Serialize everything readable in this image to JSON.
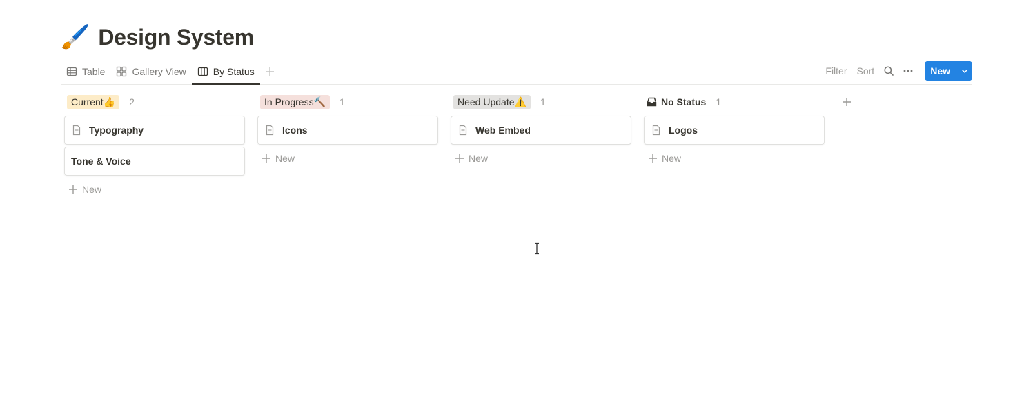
{
  "page": {
    "icon": "🖌️",
    "title": "Design System"
  },
  "views": {
    "tabs": [
      {
        "label": "Table",
        "icon": "table-icon"
      },
      {
        "label": "Gallery View",
        "icon": "gallery-icon"
      },
      {
        "label": "By Status",
        "icon": "board-icon",
        "active": true
      }
    ]
  },
  "toolbar": {
    "filter_label": "Filter",
    "sort_label": "Sort",
    "new_label": "New"
  },
  "board": {
    "columns": [
      {
        "label": "Current👍",
        "count": "2",
        "color": "#fdecc8",
        "cards": [
          "Typography",
          "Tone & Voice"
        ],
        "add_label": "New"
      },
      {
        "label": "In Progress🔨",
        "count": "1",
        "color": "#f5e0dc",
        "cards": [
          "Icons"
        ],
        "add_label": "New"
      },
      {
        "label": "Need Update⚠️",
        "count": "1",
        "color": "#e3e2e0",
        "cards": [
          "Web Embed"
        ],
        "add_label": "New"
      },
      {
        "label": "No Status",
        "count": "1",
        "color": "#ffffff",
        "cards": [
          "Logos"
        ],
        "add_label": "New"
      }
    ]
  },
  "colors": {
    "accent": "#2383e2",
    "text": "#37352f",
    "muted": "#9b9a97"
  }
}
